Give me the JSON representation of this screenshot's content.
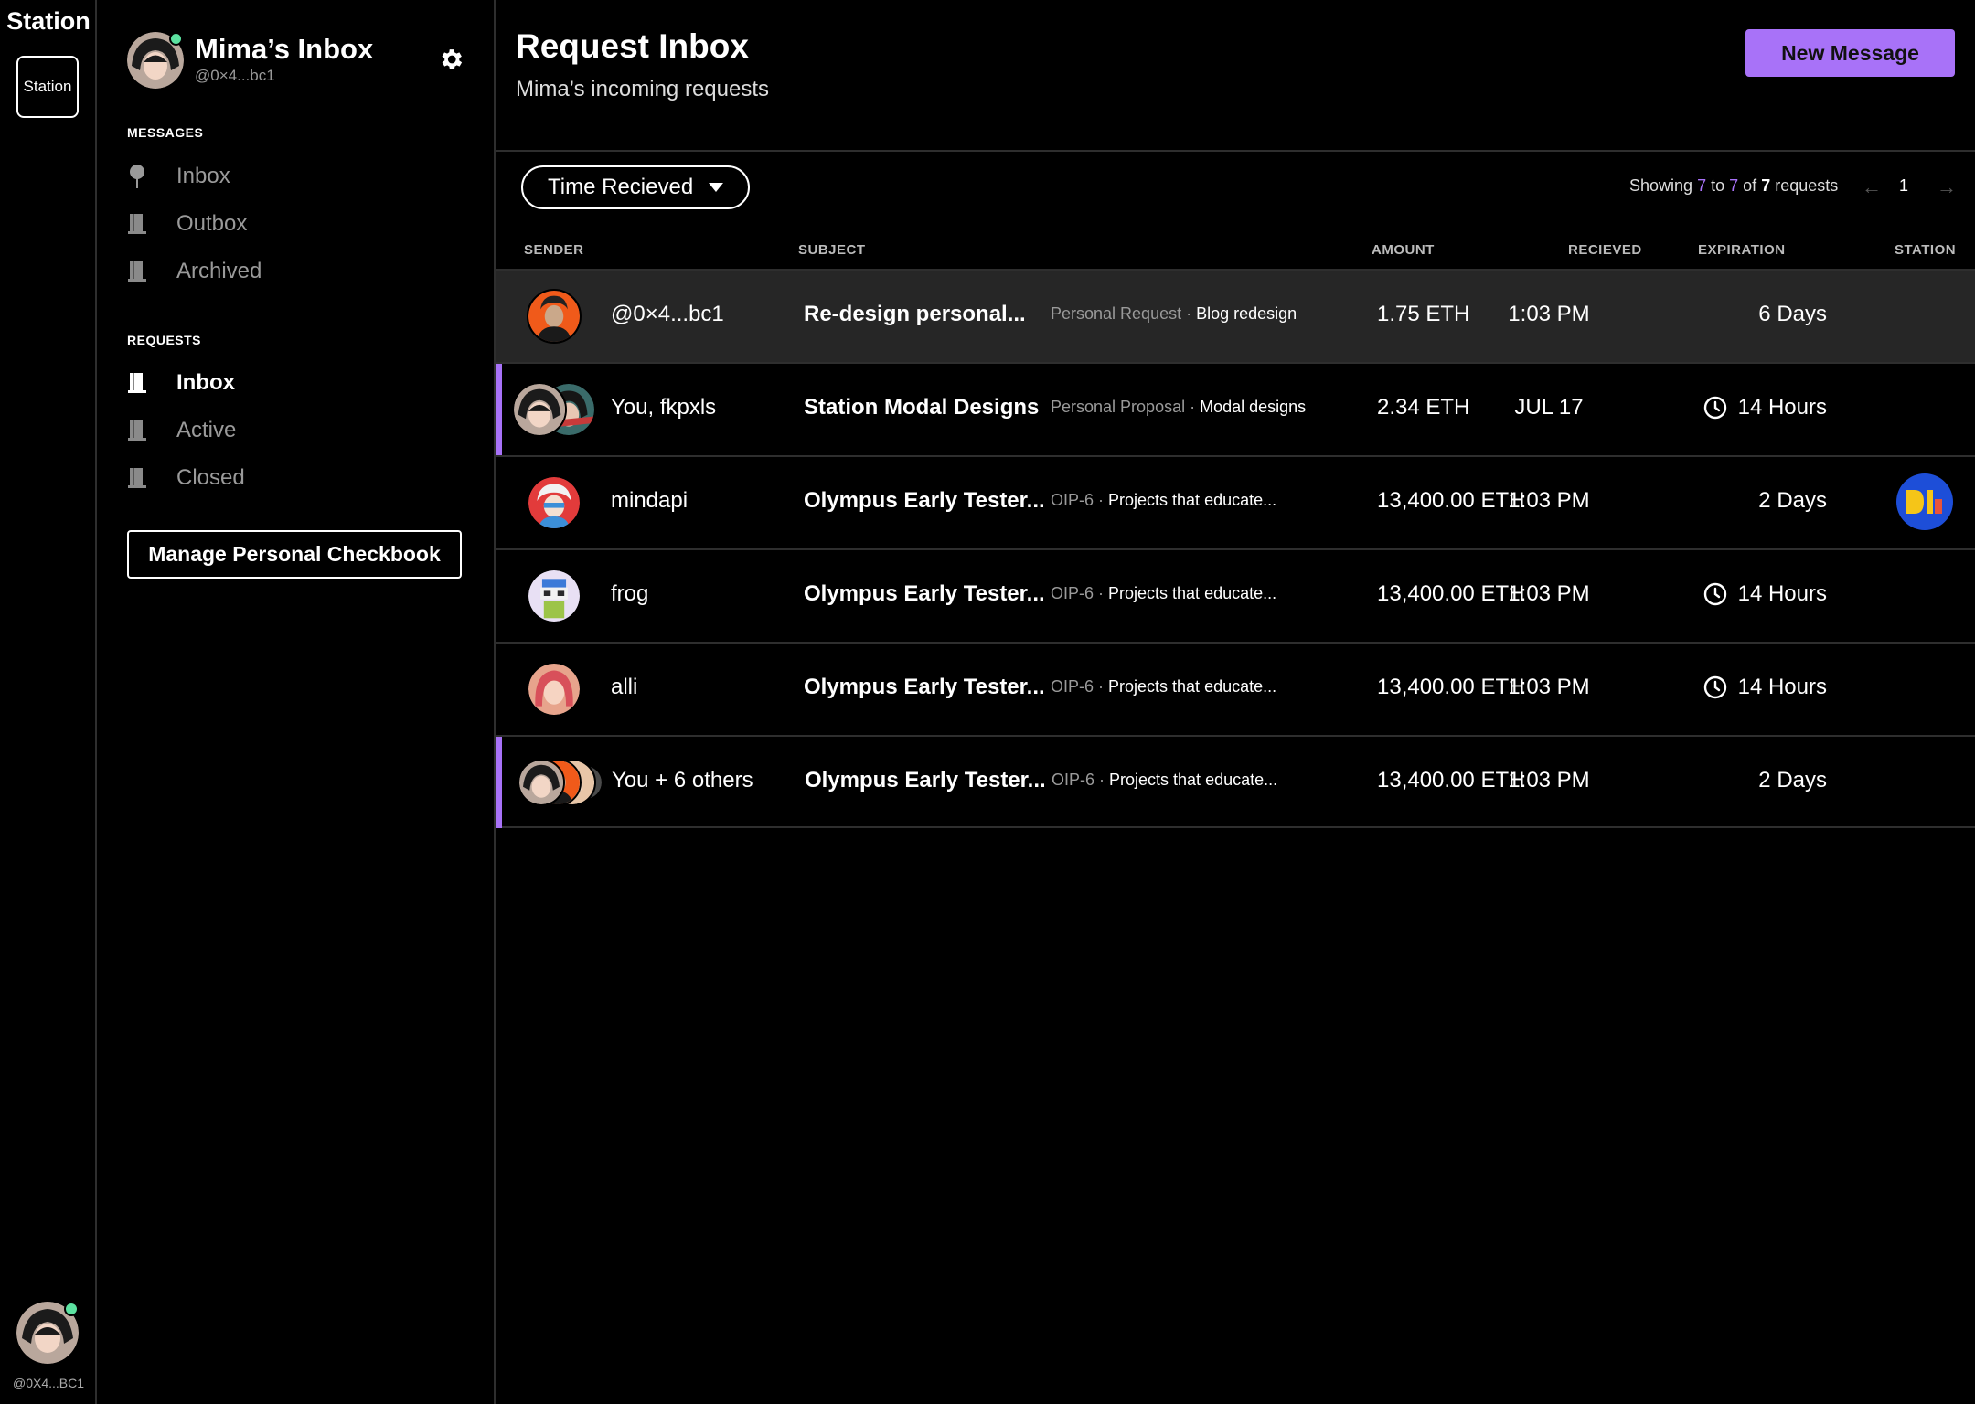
{
  "rail": {
    "title": "Station",
    "station_button": "Station",
    "user_address": "@0X4...BC1"
  },
  "sidebar": {
    "title": "Mima’s Inbox",
    "address": "@0×4...bc1",
    "messages_label": "MESSAGES",
    "messages": [
      {
        "label": "Inbox",
        "icon": "pin-icon"
      },
      {
        "label": "Outbox",
        "icon": "book-icon"
      },
      {
        "label": "Archived",
        "icon": "book-icon"
      }
    ],
    "requests_label": "REQUESTS",
    "requests": [
      {
        "label": "Inbox",
        "icon": "book-icon",
        "active": true
      },
      {
        "label": "Active",
        "icon": "book-icon"
      },
      {
        "label": "Closed",
        "icon": "book-icon"
      }
    ],
    "checkbook_button": "Manage Personal Checkbook"
  },
  "header": {
    "title": "Request Inbox",
    "subtitle": "Mima’s incoming requests",
    "new_message": "New Message"
  },
  "filter": {
    "sort_label": "Time Recieved"
  },
  "pagination": {
    "showing": "Showing",
    "from": "7",
    "to_word": "to",
    "to": "7",
    "of_word": "of",
    "total": "7",
    "suffix": "requests",
    "page": "1"
  },
  "columns": {
    "sender": "SENDER",
    "subject": "SUBJECT",
    "amount": "AMOUNT",
    "received": "RECIEVED",
    "expiration": "EXPIRATION",
    "station": "STATION"
  },
  "rows": [
    {
      "sender": "@0×4...bc1",
      "subject": "Re-design personal...",
      "type": "Personal Request",
      "sep": " · ",
      "detail": "Blog redesign",
      "amount": "1.75 ETH",
      "received": "1:03 PM",
      "expiration": "6 Days"
    },
    {
      "sender": "You, fkpxls",
      "subject": "Station Modal Designs",
      "type": "Personal Proposal",
      "sep": " · ",
      "detail": "Modal designs",
      "amount": "2.34 ETH",
      "received": "JUL 17",
      "expiration": "14 Hours"
    },
    {
      "sender": "mindapi",
      "subject": "Olympus Early Tester...",
      "type": "OIP-6",
      "sep": " · ",
      "detail": "Projects that educate...",
      "amount": "13,400.00 ETH",
      "received": "1:03 PM",
      "expiration": "2 Days"
    },
    {
      "sender": "frog",
      "subject": "Olympus Early Tester...",
      "type": "OIP-6",
      "sep": " · ",
      "detail": "Projects that educate...",
      "amount": "13,400.00 ETH",
      "received": "1:03 PM",
      "expiration": "14 Hours"
    },
    {
      "sender": "alli",
      "subject": "Olympus Early Tester...",
      "type": "OIP-6",
      "sep": " · ",
      "detail": "Projects that educate...",
      "amount": "13,400.00 ETH",
      "received": "1:03 PM",
      "expiration": "14 Hours"
    },
    {
      "sender": "You + 6 others",
      "subject": "Olympus Early Tester...",
      "type": "OIP-6",
      "sep": " · ",
      "detail": "Projects that educate...",
      "amount": "13,400.00 ETH",
      "received": "1:03 PM",
      "expiration": "2 Days"
    }
  ],
  "colors": {
    "accent": "#a872f8",
    "online": "#5ce1a0",
    "row_highlight": "#262626",
    "divider": "#2e2e2e"
  }
}
